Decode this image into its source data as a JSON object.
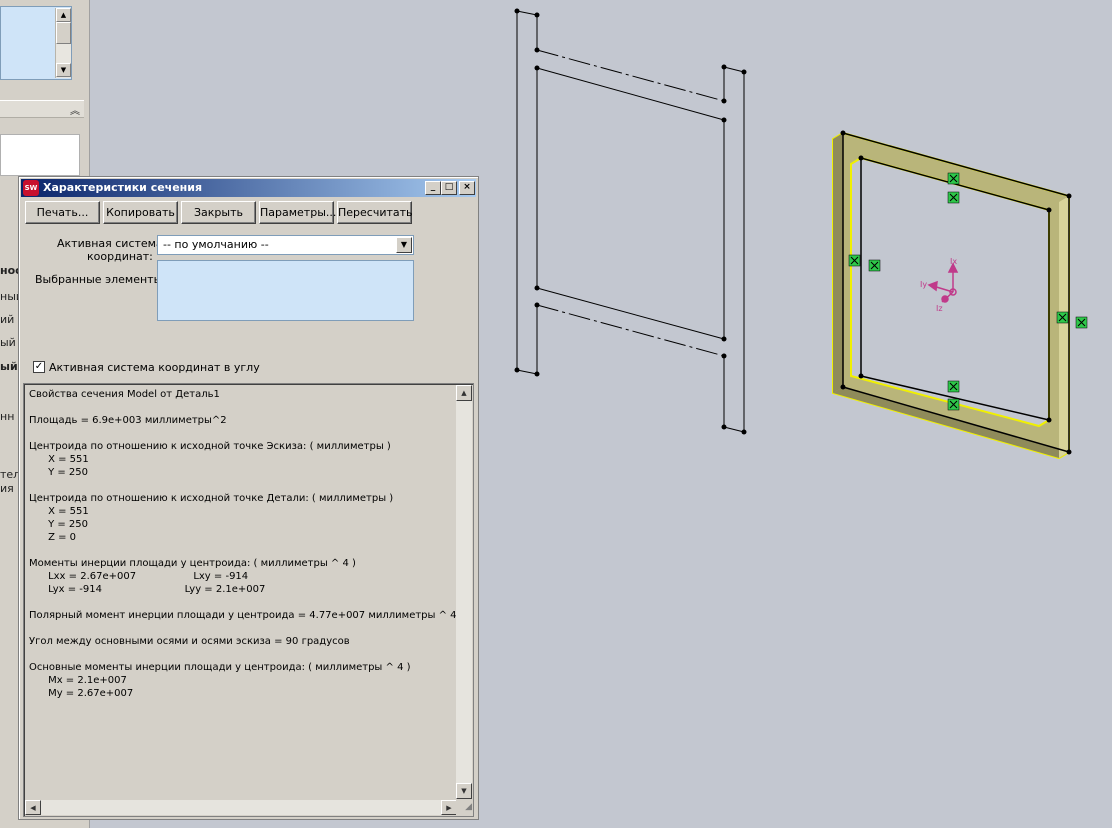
{
  "left_panel": {
    "fragments": [
      "нос",
      "ный",
      "ий",
      "ый",
      "нный",
      "нн",
      "тел",
      "ия"
    ],
    "collapse_icon": "chevrons-up-icon"
  },
  "dialog": {
    "title": "Характеристики сечения",
    "app_icon": "SW",
    "title_buttons": {
      "minimize": "_",
      "maximize": "□",
      "close": "×"
    },
    "buttons": {
      "print": "Печать...",
      "copy": "Копировать",
      "close": "Закрыть",
      "options": "Параметры...",
      "recalc": "Пересчитать"
    },
    "coord_label_1": "Активная система",
    "coord_label_2": "координат:",
    "coord_value": "-- по умолчанию --",
    "selected_label": "Выбранные элементы:",
    "corner_checkbox_label": "Активная система координат в углу",
    "corner_checked": true,
    "results": [
      "Свойства сечения Model от Деталь1",
      "",
      "Площадь = 6.9e+003 миллиметры^2",
      "",
      "Центроида по отношению к исходной точке Эскиза: ( миллиметры )",
      "      X = 551",
      "      Y = 250",
      "",
      "Центроида по отношению к исходной точке Детали: ( миллиметры )",
      "      X = 551",
      "      Y = 250",
      "      Z = 0",
      "",
      "Моменты инерции площади у центроида: ( миллиметры ^ 4 )",
      "      Lxx = 2.67e+007                  Lxy = -914",
      "      Lyx = -914                          Lyy = 2.1e+007",
      "",
      "Полярный момент инерции площади у центроида = 4.77e+007 миллиметры ^ 4",
      "",
      "Угол между основными осями и осями эскиза = 90 градусов",
      "",
      "Основные моменты инерции площади у центроида: ( миллиметры ^ 4 )",
      "      Mx = 2.1e+007",
      "      My = 2.67e+007"
    ]
  },
  "graphics": {
    "axis_labels": {
      "ix": "Ix",
      "iy": "Iy",
      "iz": "Iz"
    },
    "colors": {
      "highlight": "#f0f000",
      "frame_fill": "#b9b57a",
      "marker": "#2ec84a",
      "axis": "#c03a8a"
    }
  }
}
